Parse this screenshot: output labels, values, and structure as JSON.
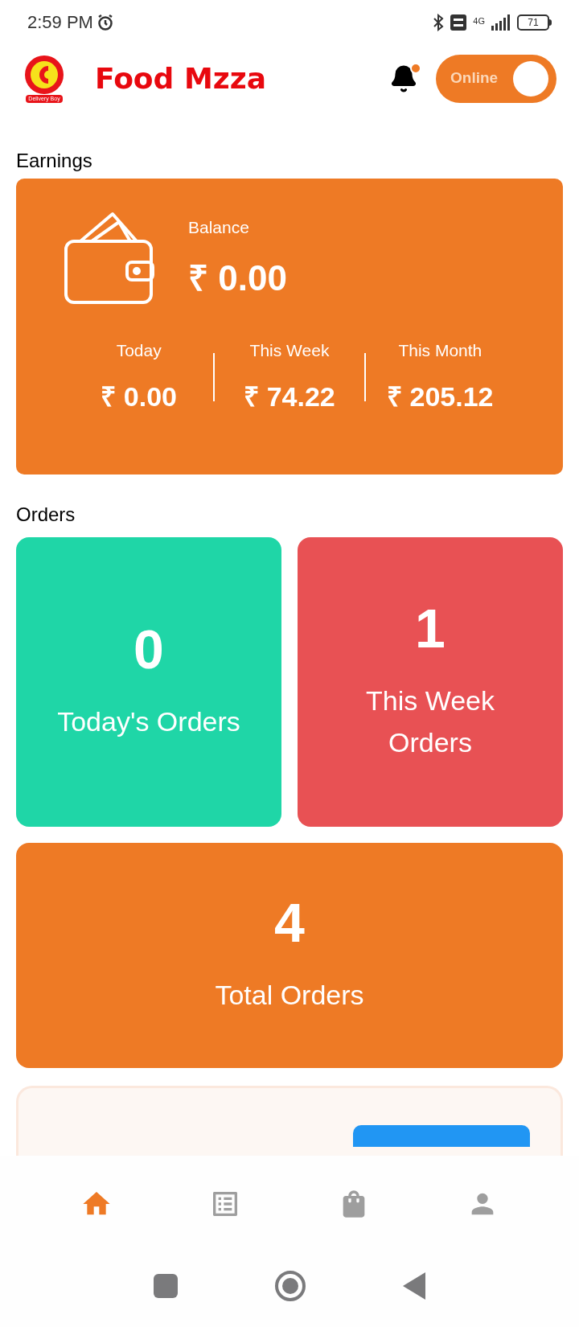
{
  "status_bar": {
    "time": "2:59 PM",
    "network": "4G",
    "battery": "71"
  },
  "header": {
    "logo_caption": "Delivery Boy",
    "title": "Food Mzza",
    "notification": {
      "unread": true
    },
    "online_toggle": {
      "label": "Online",
      "on": true
    }
  },
  "earnings": {
    "heading": "Earnings",
    "balance_label": "Balance",
    "balance": "₹ 0.00",
    "periods": [
      {
        "label": "Today",
        "amount": "₹ 0.00"
      },
      {
        "label": "This Week",
        "amount": "₹ 74.22"
      },
      {
        "label": "This Month",
        "amount": "₹ 205.12"
      }
    ]
  },
  "orders": {
    "heading": "Orders",
    "cards": [
      {
        "count": "0",
        "label": "Today's Orders",
        "color": "#1fd6a7"
      },
      {
        "count": "1",
        "label": "This Week Orders",
        "color": "#e85154"
      },
      {
        "count": "4",
        "label": "Total Orders",
        "color": "#ee7a25"
      }
    ]
  },
  "bottom_nav": [
    {
      "kind": "home",
      "selected": true
    },
    {
      "kind": "list",
      "selected": false
    },
    {
      "kind": "bag",
      "selected": false
    },
    {
      "kind": "profile",
      "selected": false
    }
  ]
}
